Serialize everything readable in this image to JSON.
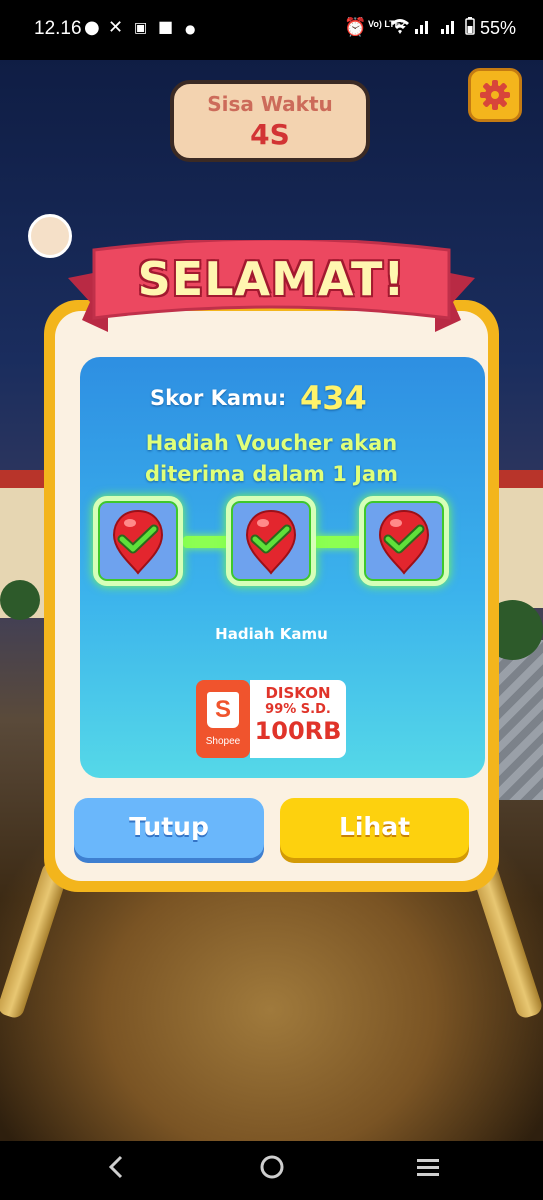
{
  "status_bar": {
    "time": "12.16",
    "battery": "55%",
    "network_label": "Vo) LTE2"
  },
  "hud": {
    "timer_label": "Sisa Waktu",
    "timer_value": "4S",
    "settings_icon": "gear-icon"
  },
  "dialog": {
    "title": "SELAMAT!",
    "score_label": "Skor Kamu:",
    "score_value": "434",
    "notice_line1": "Hadiah Voucher akan",
    "notice_line2": "diterima dalam 1 Jam",
    "steps": [
      {
        "icon": "checkmark-pin-icon",
        "completed": true
      },
      {
        "icon": "checkmark-pin-icon",
        "completed": true
      },
      {
        "icon": "checkmark-pin-icon",
        "completed": true
      }
    ],
    "reward_label": "Hadiah Kamu",
    "voucher": {
      "brand": "Shopee",
      "line1": "DISKON",
      "line2": "99% S.D.",
      "line3": "100RB"
    },
    "close_button": "Tutup",
    "view_button": "Lihat"
  },
  "colors": {
    "title_ribbon": "#e8405a",
    "dialog_border": "#f3b51c",
    "panel_blue": "#2e8fe2",
    "close_button": "#6ab7fb",
    "view_button": "#fdd10e"
  }
}
